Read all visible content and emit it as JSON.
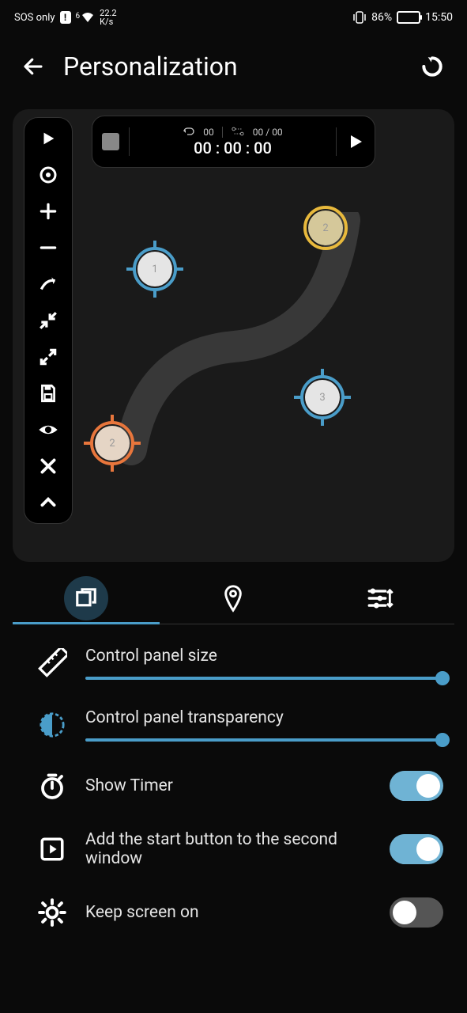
{
  "status": {
    "sos": "SOS only",
    "speed_top": "22.2",
    "speed_bottom": "K/s",
    "battery_pct": "86%",
    "time": "15:50",
    "wifi_band": "6"
  },
  "header": {
    "title": "Personalization"
  },
  "timer": {
    "loop_count": "00",
    "progress": "00 / 00",
    "time": "00 : 00 : 00"
  },
  "targets": {
    "t1": "1",
    "t2": "2",
    "t3": "3",
    "t4": "2"
  },
  "settings": {
    "panel_size_label": "Control panel size",
    "panel_transparency_label": "Control panel transparency",
    "show_timer_label": "Show Timer",
    "add_start_button_label": "Add the start button to the second window",
    "keep_screen_label": "Keep screen on"
  }
}
